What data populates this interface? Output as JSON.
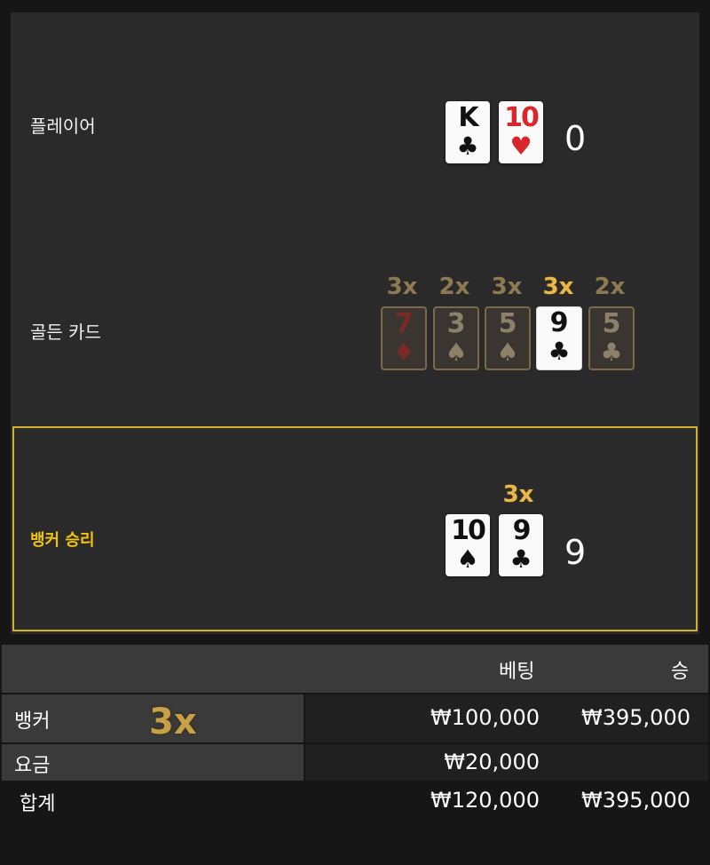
{
  "player": {
    "label": "플레이어",
    "cards": [
      {
        "rank": "K",
        "suit": "♣",
        "color": "black"
      },
      {
        "rank": "10",
        "suit": "♥",
        "color": "red"
      }
    ],
    "score": "0"
  },
  "golden": {
    "label": "골든 카드",
    "cards": [
      {
        "rank": "7",
        "suit": "♦",
        "mult": "3x",
        "active": false,
        "color": "red"
      },
      {
        "rank": "3",
        "suit": "♠",
        "mult": "2x",
        "active": false,
        "color": "black"
      },
      {
        "rank": "5",
        "suit": "♠",
        "mult": "3x",
        "active": false,
        "color": "black"
      },
      {
        "rank": "9",
        "suit": "♣",
        "mult": "3x",
        "active": true,
        "color": "black"
      },
      {
        "rank": "5",
        "suit": "♣",
        "mult": "2x",
        "active": false,
        "color": "black"
      }
    ]
  },
  "banker": {
    "label": "뱅커 승리",
    "mult": "3x",
    "cards": [
      {
        "rank": "10",
        "suit": "♠",
        "color": "black"
      },
      {
        "rank": "9",
        "suit": "♣",
        "color": "black"
      }
    ],
    "score": "9"
  },
  "table": {
    "headers": {
      "bet": "베팅",
      "win": "승"
    },
    "rows": [
      {
        "label": "뱅커",
        "mult": "3x",
        "bet": "₩100,000",
        "win": "₩395,000"
      },
      {
        "label": "요금",
        "bet": "₩20,000",
        "win": ""
      }
    ],
    "total": {
      "label": "합계",
      "bet": "₩120,000",
      "win": "₩395,000"
    }
  },
  "colors": {
    "accent": "#d4b02a",
    "bg": "#161616",
    "panel": "#2a2a2a"
  }
}
